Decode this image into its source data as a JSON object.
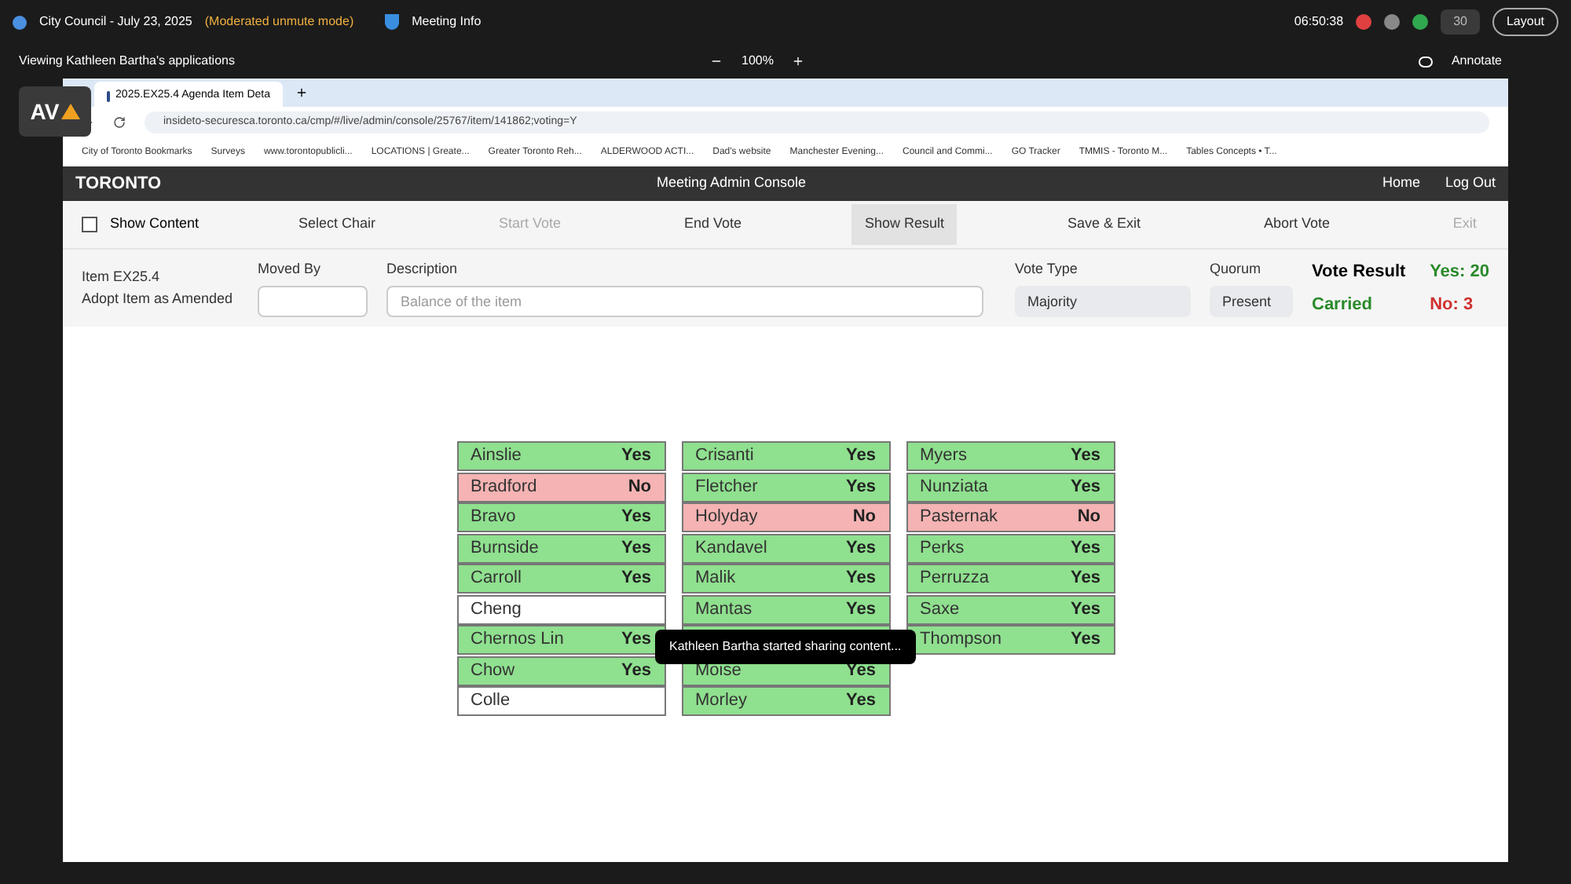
{
  "meeting_bar": {
    "title": "City Council - July 23, 2025",
    "mode": "(Moderated unmute mode)",
    "info": "Meeting Info",
    "time": "06:50:38",
    "participants": "30",
    "layout": "Layout"
  },
  "share_bar": {
    "viewing": "Viewing Kathleen Bartha's applications",
    "zoom": "100%",
    "annotate": "Annotate"
  },
  "logo": "AV",
  "browser": {
    "tab": "2025.EX25.4 Agenda Item Deta",
    "url": "insideto-securesca.toronto.ca/cmp/#/live/admin/console/25767/item/141862;voting=Y",
    "bookmarks": [
      "City of Toronto Bookmarks",
      "Surveys",
      "www.torontopublicli...",
      "LOCATIONS | Greate...",
      "Greater Toronto Reh...",
      "ALDERWOOD ACTI...",
      "Dad's website",
      "Manchester Evening...",
      "Council and Commi...",
      "GO Tracker",
      "TMMIS - Toronto M...",
      "Tables Concepts • T..."
    ]
  },
  "app": {
    "brand": "TORONTO",
    "title": "Meeting Admin Console",
    "nav": [
      "Home",
      "Log Out"
    ]
  },
  "toolbar": {
    "show_content": {
      "label": "Show Content",
      "checked": false
    },
    "actions": [
      {
        "label": "Select Chair",
        "disabled": false,
        "selected": false
      },
      {
        "label": "Start Vote",
        "disabled": true,
        "selected": false
      },
      {
        "label": "End Vote",
        "disabled": false,
        "selected": false
      },
      {
        "label": "Show Result",
        "disabled": false,
        "selected": true
      },
      {
        "label": "Save & Exit",
        "disabled": false,
        "selected": false
      },
      {
        "label": "Abort Vote",
        "disabled": false,
        "selected": false
      },
      {
        "label": "Exit",
        "disabled": true,
        "selected": false
      }
    ]
  },
  "item": {
    "id": "Item EX25.4",
    "action": "Adopt Item as Amended",
    "moved_by_label": "Moved By",
    "description_label": "Description",
    "description_placeholder": "Balance of the item",
    "vote_type_label": "Vote Type",
    "vote_type": "Majority",
    "quorum_label": "Quorum",
    "quorum": "Present",
    "result_label": "Vote Result",
    "result": "Carried",
    "yes": "Yes: 20",
    "no": "No: 3"
  },
  "columns": [
    [
      {
        "name": "Ainslie",
        "vote": "Yes",
        "color": "#8fe08f"
      },
      {
        "name": "Bradford",
        "vote": "No",
        "color": "#f5b3b3"
      },
      {
        "name": "Bravo",
        "vote": "Yes",
        "color": "#8fe08f"
      },
      {
        "name": "Burnside",
        "vote": "Yes",
        "color": "#8fe08f"
      },
      {
        "name": "Carroll",
        "vote": "Yes",
        "color": "#8fe08f"
      },
      {
        "name": "Cheng",
        "color": "#ffffff"
      },
      {
        "name": "Chernos Lin",
        "vote": "Yes",
        "color": "#8fe08f"
      },
      {
        "name": "Chow",
        "vote": "Yes",
        "color": "#8fe08f"
      },
      {
        "name": "Colle",
        "color": "#ffffff"
      }
    ],
    [
      {
        "name": "Crisanti",
        "vote": "Yes",
        "color": "#8fe08f"
      },
      {
        "name": "Fletcher",
        "vote": "Yes",
        "color": "#8fe08f"
      },
      {
        "name": "Holyday",
        "vote": "No",
        "color": "#f5b3b3"
      },
      {
        "name": "Kandavel",
        "vote": "Yes",
        "color": "#8fe08f"
      },
      {
        "name": "Malik",
        "vote": "Yes",
        "color": "#8fe08f"
      },
      {
        "name": "Mantas",
        "vote": "Yes",
        "color": "#8fe08f"
      },
      {
        "color": "#8fe08f"
      },
      {
        "name": "Moise",
        "vote": "Yes",
        "color": "#8fe08f"
      },
      {
        "name": "Morley",
        "vote": "Yes",
        "color": "#8fe08f"
      }
    ],
    [
      {
        "name": "Myers",
        "vote": "Yes",
        "color": "#8fe08f"
      },
      {
        "name": "Nunziata",
        "vote": "Yes",
        "color": "#8fe08f"
      },
      {
        "name": "Pasternak",
        "vote": "No",
        "color": "#f5b3b3"
      },
      {
        "name": "Perks",
        "vote": "Yes",
        "color": "#8fe08f"
      },
      {
        "name": "Perruzza",
        "vote": "Yes",
        "color": "#8fe08f"
      },
      {
        "name": "Saxe",
        "vote": "Yes",
        "color": "#8fe08f"
      },
      {
        "name": "Thompson",
        "vote": "Yes",
        "color": "#8fe08f"
      }
    ]
  ],
  "toast": "Kathleen Bartha started sharing content..."
}
